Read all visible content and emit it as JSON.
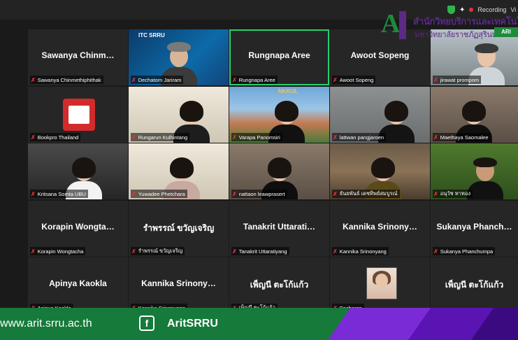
{
  "topbar": {
    "recording_label": "Recording",
    "view_label": "Vi"
  },
  "logo": {
    "line1": "สำนักวิทยบริการและเทคโนโลย",
    "line2": "มหาวิทยาลัยราชภัฏสุรินทร์",
    "badge": "ARI"
  },
  "tiles": [
    {
      "big": "Sawanya  Chinm…",
      "name": "Sawanya Chinmethiphithak"
    },
    {
      "big": "",
      "name": "Dechatorn Jariram",
      "overlay": "ITC SRRU"
    },
    {
      "big": "Rungnapa Aree",
      "name": "Rungnapa Aree"
    },
    {
      "big": "Awoot Sopeng",
      "name": "Awoot Sopeng"
    },
    {
      "big": "",
      "name": "jirawat prompom"
    },
    {
      "big": "",
      "name": "Bookpro Thailand"
    },
    {
      "big": "",
      "name": "Rungarun Kulhintang"
    },
    {
      "big": "",
      "name": "Varapa Panomsiri",
      "overlay": "NKKUL"
    },
    {
      "big": "",
      "name": "lattwan pangjaroen"
    },
    {
      "big": "",
      "name": "Maethaya Saomalee"
    },
    {
      "big": "",
      "name": "Kritsana Somta UBU"
    },
    {
      "big": "",
      "name": "Yuwadee Phetchara"
    },
    {
      "big": "",
      "name": "nattaon leawprasert"
    },
    {
      "big": "",
      "name": "ธันยพันธ์ เดชทิพย์สมบูรณ์"
    },
    {
      "big": "",
      "name": "อนุวัช ทาทอง"
    },
    {
      "big": "Korapin  Wongta…",
      "name": "Korapin Wongtacha"
    },
    {
      "big": "รำพรรณ์  ขวัญเจริญ",
      "name": "รำพรรณ์ ขวัญเจริญ"
    },
    {
      "big": "Tanakrit  Uttarati…",
      "name": "Tanakrit Uttaratiyang"
    },
    {
      "big": "Kannika  Srinony…",
      "name": "Kannika Srinonyang"
    },
    {
      "big": "Sukanya  Phanch…",
      "name": "Sukanya Phanchumpa"
    },
    {
      "big": "Apinya  Kaokla",
      "name": "Apinya Kaokla"
    },
    {
      "big": "Kannika  Srinony…",
      "name": "Kannika Srinonyang"
    },
    {
      "big": "เพ็ญนี  ตะโก้แก้ว",
      "name": "เพ็ญนี ตะโก้แก้ว"
    },
    {
      "big": "",
      "name": "Pacharap"
    },
    {
      "big": "เพ็ญนี  ตะโก้แก้ว",
      "name": ""
    }
  ],
  "footer": {
    "url": "www.arit.srru.ac.th",
    "fb_glyph": "f",
    "handle": "AritSRRU"
  }
}
